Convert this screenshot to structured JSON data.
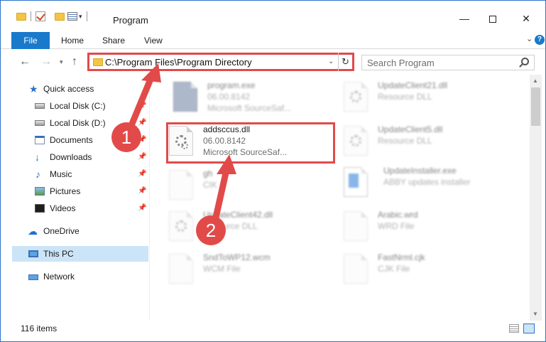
{
  "window": {
    "title": "Program",
    "min_glyph": "—",
    "close_glyph": "✕"
  },
  "ribbon": {
    "tabs": [
      "File",
      "Home",
      "Share",
      "View"
    ]
  },
  "address": {
    "path": "C:\\Program Files\\Program Directory"
  },
  "search": {
    "placeholder": "Search Program"
  },
  "navpane": {
    "items": [
      {
        "label": "Quick access",
        "icon": "star-icon"
      },
      {
        "label": "Local Disk (C:)",
        "icon": "drive-icon",
        "pinned": true
      },
      {
        "label": "Local Disk (D:)",
        "icon": "drive-icon",
        "pinned": true
      },
      {
        "label": "Documents",
        "icon": "documents-icon",
        "pinned": true
      },
      {
        "label": "Downloads",
        "icon": "download-icon",
        "pinned": true
      },
      {
        "label": "Music",
        "icon": "music-icon",
        "pinned": true
      },
      {
        "label": "Pictures",
        "icon": "pictures-icon",
        "pinned": true
      },
      {
        "label": "Videos",
        "icon": "videos-icon",
        "pinned": true
      },
      {
        "label": "OneDrive",
        "icon": "cloud-icon"
      },
      {
        "label": "This PC",
        "icon": "computer-icon",
        "selected": true
      },
      {
        "label": "Network",
        "icon": "network-icon"
      }
    ]
  },
  "files": {
    "program_exe": {
      "name": "program.exe",
      "line2": "06.00.8142",
      "line3": "Microsoft SourceSaf..."
    },
    "addsccus": {
      "name": "addsccus.dll",
      "line2": "06.00.8142",
      "line3": "Microsoft SourceSaf..."
    },
    "gh": {
      "name": "gh",
      "line2": "CIK"
    },
    "updateclient42": {
      "name": "UpdateClient42.dll",
      "line2": "Resource DLL"
    },
    "sndtowp12": {
      "name": "SndToWP12.wcm",
      "line2": "WCM File"
    },
    "updateclient21": {
      "name": "UpdateClient21.dll",
      "line2": "Resource DLL"
    },
    "updateclient5": {
      "name": "UpdateClient5.dll",
      "line2": "Resource DLL"
    },
    "updateinstaller": {
      "name": "UpdateInstaller.exe",
      "line2": "ABBY updates installer"
    },
    "arabic": {
      "name": "Arabic.wrd",
      "line2": "WRD File"
    },
    "fastnrml": {
      "name": "FastNrml.cjk",
      "line2": "CJK File"
    }
  },
  "status": {
    "item_count": "116 items"
  },
  "callouts": {
    "one": "1",
    "two": "2",
    "color": "#e24a4a"
  },
  "colors": {
    "accent": "#1979ca",
    "selection": "#cce4f7"
  }
}
